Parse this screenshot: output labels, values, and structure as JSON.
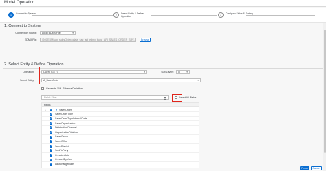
{
  "window": {
    "title": "Model Operation"
  },
  "wizard": {
    "steps": [
      {
        "number": "1",
        "label": "Connect to System"
      },
      {
        "number": "2",
        "label": "Select Entity & Define Operation"
      },
      {
        "number": "3",
        "label": "Configure Fields & Sorting"
      }
    ]
  },
  "section1": {
    "title": "1. Connect to System",
    "connection_source_label": "Connection Source:",
    "connection_source_value": "Local EDMX File",
    "edmx_file_label": "EDMX File:",
    "edmx_file_value": "/Sy0/EDM/sap_salesOrder/odata_sap_api_edmx_bupa_API_SALES_ORDER_SRV...",
    "browse_label": "Browse"
  },
  "section2": {
    "title": "2. Select Entity & Define Operation",
    "operation_label": "Operation:",
    "operation_value": "Query (GET)",
    "sub_levels_label": "Sub Levels:",
    "sub_levels_value": "0",
    "select_entity_label": "Select Entity:",
    "select_entity_value": "A_SalesOrder",
    "generate_xsd_label": "Generate XML Schema Definition",
    "filter_placeholder": "Fields Filter",
    "select_all_label": "Select All Fields",
    "fields_header": "Fields",
    "fields": [
      {
        "name": "SalesOrder",
        "checked": true,
        "key": true
      },
      {
        "name": "SalesOrderType",
        "checked": true,
        "key": false
      },
      {
        "name": "SalesOrderTypeInternalCode",
        "checked": true,
        "key": false
      },
      {
        "name": "SalesOrganization",
        "checked": true,
        "key": false
      },
      {
        "name": "DistributionChannel",
        "checked": true,
        "key": false
      },
      {
        "name": "OrganizationDivision",
        "checked": true,
        "key": false
      },
      {
        "name": "SalesGroup",
        "checked": true,
        "key": false
      },
      {
        "name": "SalesOffice",
        "checked": true,
        "key": false
      },
      {
        "name": "SalesDistrict",
        "checked": true,
        "key": false
      },
      {
        "name": "SoldToParty",
        "checked": true,
        "key": false
      },
      {
        "name": "CreationDate",
        "checked": true,
        "key": false
      },
      {
        "name": "CreatedByUser",
        "checked": true,
        "key": false
      },
      {
        "name": "LastChangeDate",
        "checked": true,
        "key": false
      }
    ]
  },
  "footer": {
    "finish_label": "Finish",
    "cancel_label": "Cancel"
  },
  "colors": {
    "accent": "#0a6ed1",
    "highlight": "#e0251b"
  }
}
